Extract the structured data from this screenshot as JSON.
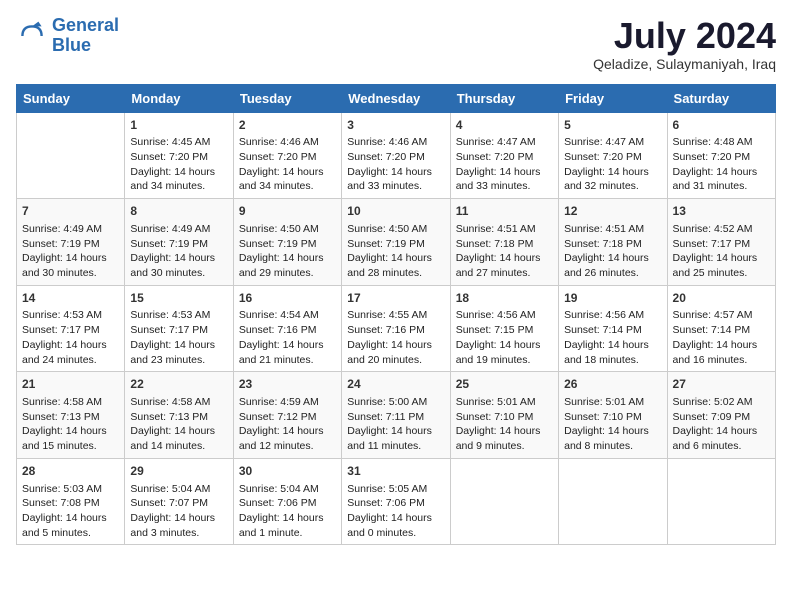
{
  "header": {
    "logo_line1": "General",
    "logo_line2": "Blue",
    "month_title": "July 2024",
    "location": "Qeladize, Sulaymaniyah, Iraq"
  },
  "weekdays": [
    "Sunday",
    "Monday",
    "Tuesday",
    "Wednesday",
    "Thursday",
    "Friday",
    "Saturday"
  ],
  "weeks": [
    [
      {
        "day": "",
        "info": ""
      },
      {
        "day": "1",
        "info": "Sunrise: 4:45 AM\nSunset: 7:20 PM\nDaylight: 14 hours\nand 34 minutes."
      },
      {
        "day": "2",
        "info": "Sunrise: 4:46 AM\nSunset: 7:20 PM\nDaylight: 14 hours\nand 34 minutes."
      },
      {
        "day": "3",
        "info": "Sunrise: 4:46 AM\nSunset: 7:20 PM\nDaylight: 14 hours\nand 33 minutes."
      },
      {
        "day": "4",
        "info": "Sunrise: 4:47 AM\nSunset: 7:20 PM\nDaylight: 14 hours\nand 33 minutes."
      },
      {
        "day": "5",
        "info": "Sunrise: 4:47 AM\nSunset: 7:20 PM\nDaylight: 14 hours\nand 32 minutes."
      },
      {
        "day": "6",
        "info": "Sunrise: 4:48 AM\nSunset: 7:20 PM\nDaylight: 14 hours\nand 31 minutes."
      }
    ],
    [
      {
        "day": "7",
        "info": "Sunrise: 4:49 AM\nSunset: 7:19 PM\nDaylight: 14 hours\nand 30 minutes."
      },
      {
        "day": "8",
        "info": "Sunrise: 4:49 AM\nSunset: 7:19 PM\nDaylight: 14 hours\nand 30 minutes."
      },
      {
        "day": "9",
        "info": "Sunrise: 4:50 AM\nSunset: 7:19 PM\nDaylight: 14 hours\nand 29 minutes."
      },
      {
        "day": "10",
        "info": "Sunrise: 4:50 AM\nSunset: 7:19 PM\nDaylight: 14 hours\nand 28 minutes."
      },
      {
        "day": "11",
        "info": "Sunrise: 4:51 AM\nSunset: 7:18 PM\nDaylight: 14 hours\nand 27 minutes."
      },
      {
        "day": "12",
        "info": "Sunrise: 4:51 AM\nSunset: 7:18 PM\nDaylight: 14 hours\nand 26 minutes."
      },
      {
        "day": "13",
        "info": "Sunrise: 4:52 AM\nSunset: 7:17 PM\nDaylight: 14 hours\nand 25 minutes."
      }
    ],
    [
      {
        "day": "14",
        "info": "Sunrise: 4:53 AM\nSunset: 7:17 PM\nDaylight: 14 hours\nand 24 minutes."
      },
      {
        "day": "15",
        "info": "Sunrise: 4:53 AM\nSunset: 7:17 PM\nDaylight: 14 hours\nand 23 minutes."
      },
      {
        "day": "16",
        "info": "Sunrise: 4:54 AM\nSunset: 7:16 PM\nDaylight: 14 hours\nand 21 minutes."
      },
      {
        "day": "17",
        "info": "Sunrise: 4:55 AM\nSunset: 7:16 PM\nDaylight: 14 hours\nand 20 minutes."
      },
      {
        "day": "18",
        "info": "Sunrise: 4:56 AM\nSunset: 7:15 PM\nDaylight: 14 hours\nand 19 minutes."
      },
      {
        "day": "19",
        "info": "Sunrise: 4:56 AM\nSunset: 7:14 PM\nDaylight: 14 hours\nand 18 minutes."
      },
      {
        "day": "20",
        "info": "Sunrise: 4:57 AM\nSunset: 7:14 PM\nDaylight: 14 hours\nand 16 minutes."
      }
    ],
    [
      {
        "day": "21",
        "info": "Sunrise: 4:58 AM\nSunset: 7:13 PM\nDaylight: 14 hours\nand 15 minutes."
      },
      {
        "day": "22",
        "info": "Sunrise: 4:58 AM\nSunset: 7:13 PM\nDaylight: 14 hours\nand 14 minutes."
      },
      {
        "day": "23",
        "info": "Sunrise: 4:59 AM\nSunset: 7:12 PM\nDaylight: 14 hours\nand 12 minutes."
      },
      {
        "day": "24",
        "info": "Sunrise: 5:00 AM\nSunset: 7:11 PM\nDaylight: 14 hours\nand 11 minutes."
      },
      {
        "day": "25",
        "info": "Sunrise: 5:01 AM\nSunset: 7:10 PM\nDaylight: 14 hours\nand 9 minutes."
      },
      {
        "day": "26",
        "info": "Sunrise: 5:01 AM\nSunset: 7:10 PM\nDaylight: 14 hours\nand 8 minutes."
      },
      {
        "day": "27",
        "info": "Sunrise: 5:02 AM\nSunset: 7:09 PM\nDaylight: 14 hours\nand 6 minutes."
      }
    ],
    [
      {
        "day": "28",
        "info": "Sunrise: 5:03 AM\nSunset: 7:08 PM\nDaylight: 14 hours\nand 5 minutes."
      },
      {
        "day": "29",
        "info": "Sunrise: 5:04 AM\nSunset: 7:07 PM\nDaylight: 14 hours\nand 3 minutes."
      },
      {
        "day": "30",
        "info": "Sunrise: 5:04 AM\nSunset: 7:06 PM\nDaylight: 14 hours\nand 1 minute."
      },
      {
        "day": "31",
        "info": "Sunrise: 5:05 AM\nSunset: 7:06 PM\nDaylight: 14 hours\nand 0 minutes."
      },
      {
        "day": "",
        "info": ""
      },
      {
        "day": "",
        "info": ""
      },
      {
        "day": "",
        "info": ""
      }
    ]
  ]
}
